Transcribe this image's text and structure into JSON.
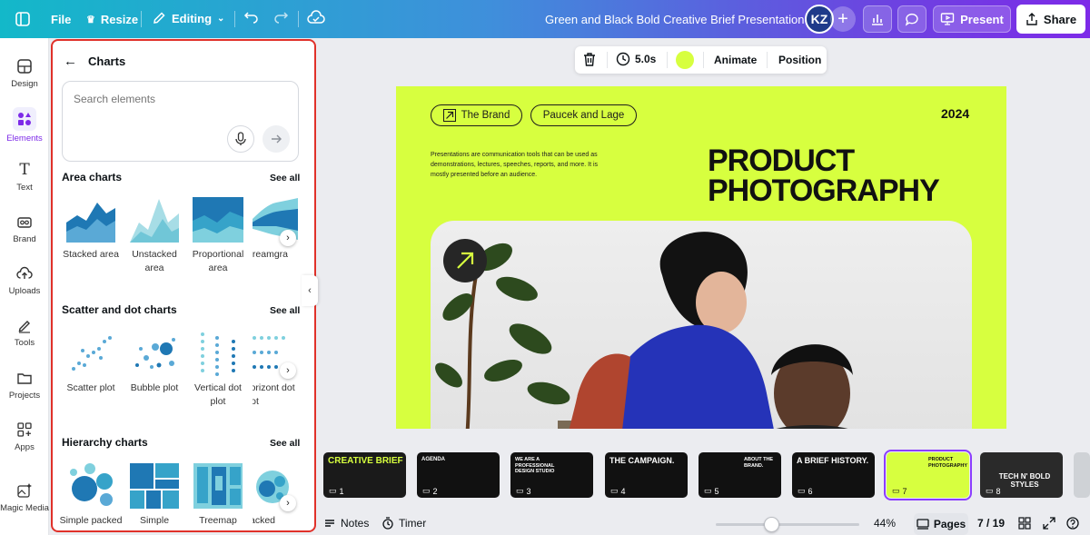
{
  "topbar": {
    "file_label": "File",
    "resize_label": "Resize",
    "editing_label": "Editing",
    "document_title": "Green and Black Bold Creative Brief Presentation",
    "avatar_initials": "KZ",
    "present_label": "Present",
    "share_label": "Share"
  },
  "rail": {
    "items": [
      {
        "label": "Design",
        "icon": "design-icon"
      },
      {
        "label": "Elements",
        "icon": "elements-icon"
      },
      {
        "label": "Text",
        "icon": "text-icon"
      },
      {
        "label": "Brand",
        "icon": "brand-icon"
      },
      {
        "label": "Uploads",
        "icon": "uploads-icon"
      },
      {
        "label": "Tools",
        "icon": "tools-icon"
      },
      {
        "label": "Projects",
        "icon": "projects-icon"
      },
      {
        "label": "Apps",
        "icon": "apps-icon"
      },
      {
        "label": "Magic Media",
        "icon": "magic-media-icon"
      }
    ]
  },
  "panel": {
    "title": "Charts",
    "search_placeholder": "Search elements",
    "sections": [
      {
        "title": "Area charts",
        "see_all": "See all",
        "items": [
          "Stacked area",
          "Unstacked area",
          "Proportional area",
          "Streamgra"
        ]
      },
      {
        "title": "Scatter and dot charts",
        "see_all": "See all",
        "items": [
          "Scatter plot",
          "Bubble plot",
          "Vertical dot plot",
          "Horizont dot plot"
        ]
      },
      {
        "title": "Hierarchy charts",
        "see_all": "See all",
        "items": [
          "Simple packed",
          "Simple treemap",
          "Treemap",
          "Packed"
        ]
      }
    ]
  },
  "toolbar": {
    "duration": "5.0s",
    "animate_label": "Animate",
    "position_label": "Position",
    "color_swatch": "#d7ff3f"
  },
  "slide": {
    "pill1": "The Brand",
    "pill2": "Paucek and Lage",
    "year": "2024",
    "description": "Presentations are communication tools that can be used as demonstrations, lectures, speeches, reports, and more. It is mostly presented before an audience.",
    "headline_line1": "PRODUCT",
    "headline_line2": "PHOTOGRAPHY",
    "background": "#d7ff3f"
  },
  "thumbnails": [
    {
      "num": "1",
      "title": "CREATIVE BRIEF"
    },
    {
      "num": "2",
      "title": "AGENDA"
    },
    {
      "num": "3",
      "title": "WE ARE A PROFESSIONAL DESIGN STUDIO"
    },
    {
      "num": "4",
      "title": "THE CAMPAIGN."
    },
    {
      "num": "5",
      "title": "ABOUT THE BRAND."
    },
    {
      "num": "6",
      "title": "A BRIEF HISTORY."
    },
    {
      "num": "7",
      "title": "PRODUCT PHOTOGRAPHY"
    },
    {
      "num": "8",
      "title": "TECH N' BOLD STYLES"
    }
  ],
  "bottombar": {
    "notes_label": "Notes",
    "timer_label": "Timer",
    "zoom": "44%",
    "pages_label": "Pages",
    "page_counter": "7 / 19"
  }
}
